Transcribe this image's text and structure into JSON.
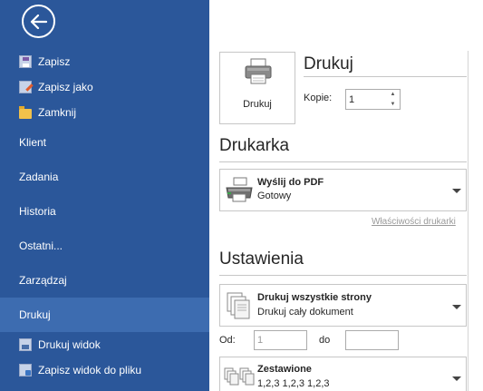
{
  "sidebar": {
    "file_actions": [
      {
        "label": "Zapisz",
        "icon": "save-icon"
      },
      {
        "label": "Zapisz jako",
        "icon": "save-as-icon"
      },
      {
        "label": "Zamknij",
        "icon": "folder-icon"
      }
    ],
    "nav": [
      {
        "label": "Klient"
      },
      {
        "label": "Zadania"
      },
      {
        "label": "Historia"
      },
      {
        "label": "Ostatni..."
      },
      {
        "label": "Zarządzaj"
      },
      {
        "label": "Drukuj",
        "active": true
      }
    ],
    "sub_actions": [
      {
        "label": "Drukuj widok",
        "icon": "print-view-icon"
      },
      {
        "label": "Zapisz widok do pliku",
        "icon": "save-file-icon"
      }
    ],
    "colors": {
      "background": "#2b579a",
      "active": "#3d6cb0"
    }
  },
  "print": {
    "title": "Drukuj",
    "button_label": "Drukuj",
    "copies_label": "Kopie:",
    "copies_value": "1"
  },
  "printer": {
    "title": "Drukarka",
    "name": "Wyślij do PDF",
    "status": "Gotowy",
    "properties_link": "Właściwości drukarki"
  },
  "settings": {
    "title": "Ustawienia",
    "pages": {
      "main": "Drukuj wszystkie strony",
      "sub": "Drukuj cały dokument"
    },
    "range": {
      "from_label": "Od:",
      "from_value": "1",
      "to_label": "do",
      "to_value": ""
    },
    "collation": {
      "main": "Zestawione",
      "sub": "1,2,3   1,2,3   1,2,3"
    }
  }
}
